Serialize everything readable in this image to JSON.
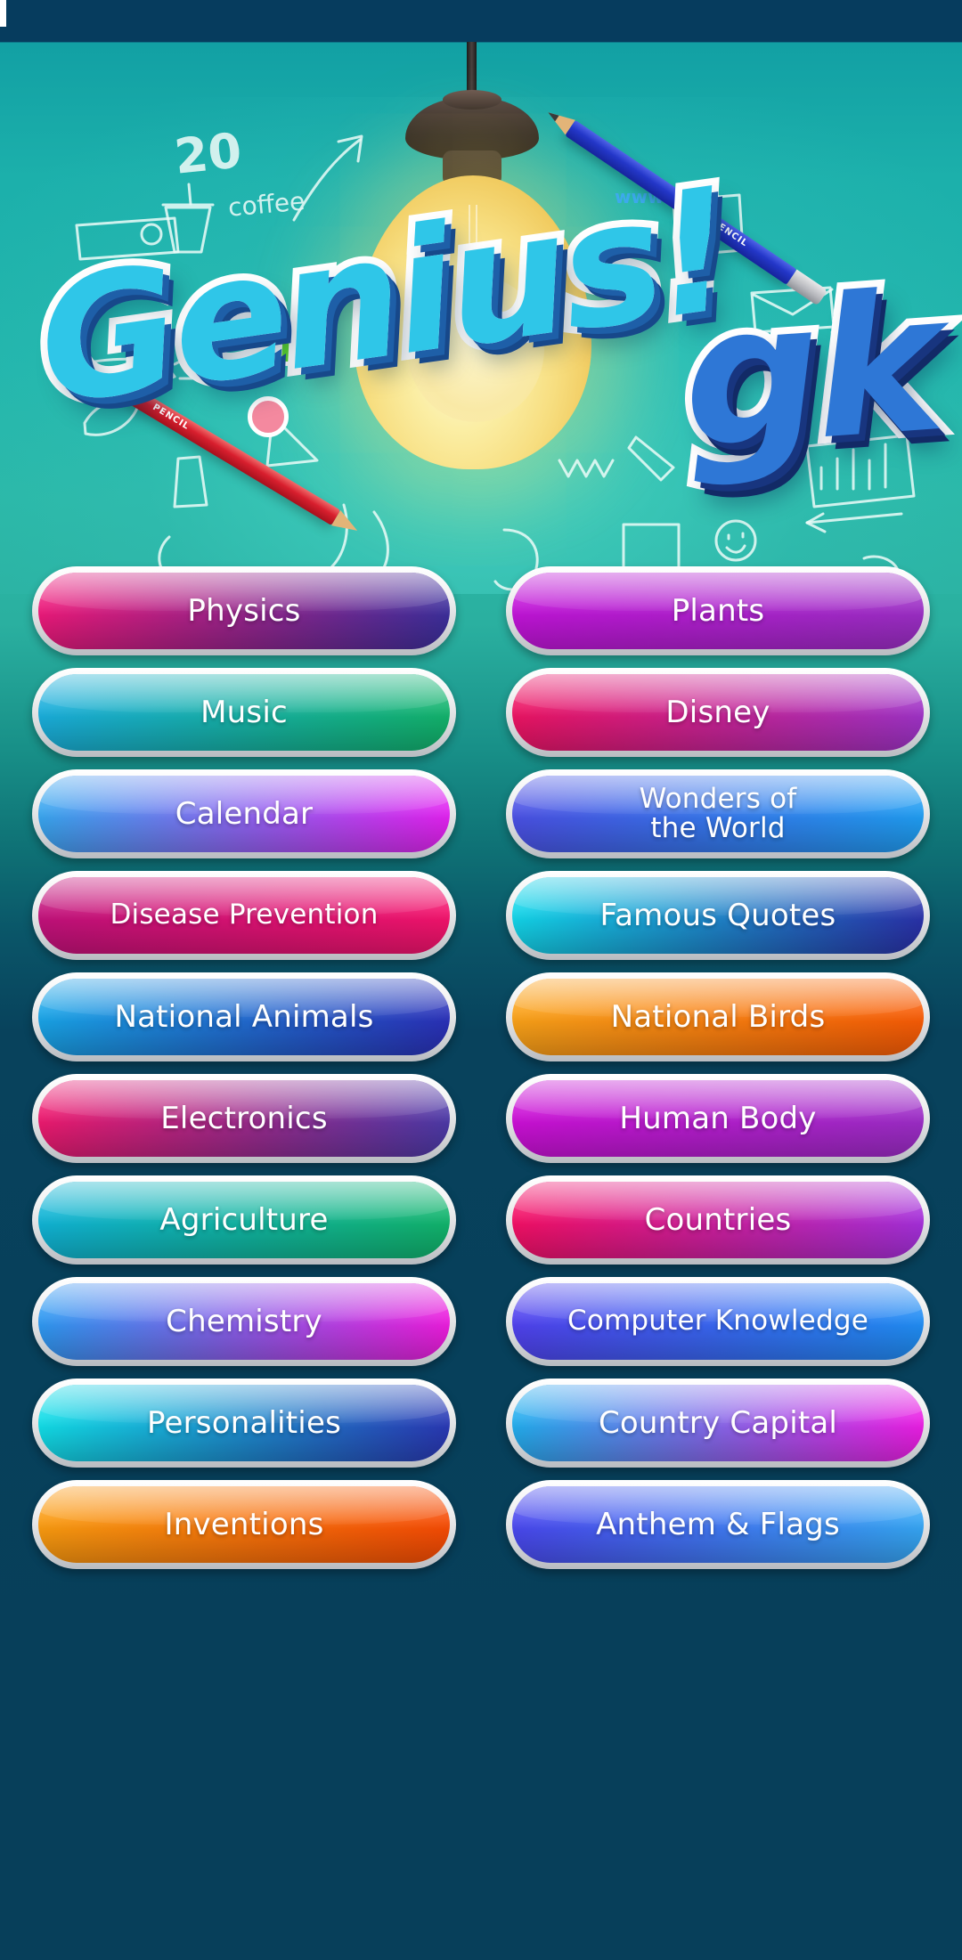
{
  "app": {
    "title": "Genius! GK",
    "logo_main": "Genius!",
    "logo_sub": "gk",
    "background_top_color": "#1cb0ab",
    "background_bottom_color": "#073f5a",
    "statusbar_color": "#063c5e"
  },
  "decor": {
    "lamp": "light-bulb",
    "pencil_blue_label": "PENCIL",
    "pencil_red_label": "PENCIL",
    "doodles": [
      "20",
      "coffee",
      "www...",
      "e-maie"
    ]
  },
  "menu": {
    "items": [
      {
        "label": "Physics",
        "c1": "#f0197a",
        "c2": "#3a2f9c",
        "lines": 1
      },
      {
        "label": "Plants",
        "c1": "#c213d8",
        "c2": "#9a2ec4",
        "lines": 1
      },
      {
        "label": "Music",
        "c1": "#1aaede",
        "c2": "#12b36a",
        "lines": 1
      },
      {
        "label": "Disney",
        "c1": "#ee1361",
        "c2": "#9e33c8",
        "lines": 1
      },
      {
        "label": "Calendar",
        "c1": "#35a8ef",
        "c2": "#e420f0",
        "lines": 1
      },
      {
        "label": "Wonders of\nthe World",
        "c1": "#4b4fe4",
        "c2": "#1f9ef2",
        "lines": 2
      },
      {
        "label": "Disease Prevention",
        "c1": "#c1117b",
        "c2": "#f4136c",
        "lines": 1
      },
      {
        "label": "Famous Quotes",
        "c1": "#12d8ea",
        "c2": "#2a2fa8",
        "lines": 1
      },
      {
        "label": "National Animals",
        "c1": "#18a6e8",
        "c2": "#2a2fb8",
        "lines": 1
      },
      {
        "label": "National Birds",
        "c1": "#faa319",
        "c2": "#f75a05",
        "lines": 1
      },
      {
        "label": "Electronics",
        "c1": "#f0196e",
        "c2": "#4a3aa8",
        "lines": 1
      },
      {
        "label": "Human Body",
        "c1": "#cc0fd6",
        "c2": "#9b2dc6",
        "lines": 1
      },
      {
        "label": "Agriculture",
        "c1": "#10b4d8",
        "c2": "#11b46a",
        "lines": 1
      },
      {
        "label": "Countries",
        "c1": "#f50f63",
        "c2": "#a430dc",
        "lines": 1
      },
      {
        "label": "Chemistry",
        "c1": "#2a9bf2",
        "c2": "#ef1bdd",
        "lines": 1
      },
      {
        "label": "Computer Knowledge",
        "c1": "#5140ee",
        "c2": "#1f8ef4",
        "lines": 1
      },
      {
        "label": "Personalities",
        "c1": "#11e0e8",
        "c2": "#2a36b4",
        "lines": 1
      },
      {
        "label": "Country Capital",
        "c1": "#1fb0ee",
        "c2": "#ee1ce4",
        "lines": 1
      },
      {
        "label": "Inventions",
        "c1": "#fa9c10",
        "c2": "#f64a04",
        "lines": 1
      },
      {
        "label": "Anthem & Flags",
        "c1": "#4a46ee",
        "c2": "#35a7f4",
        "lines": 1
      }
    ]
  }
}
